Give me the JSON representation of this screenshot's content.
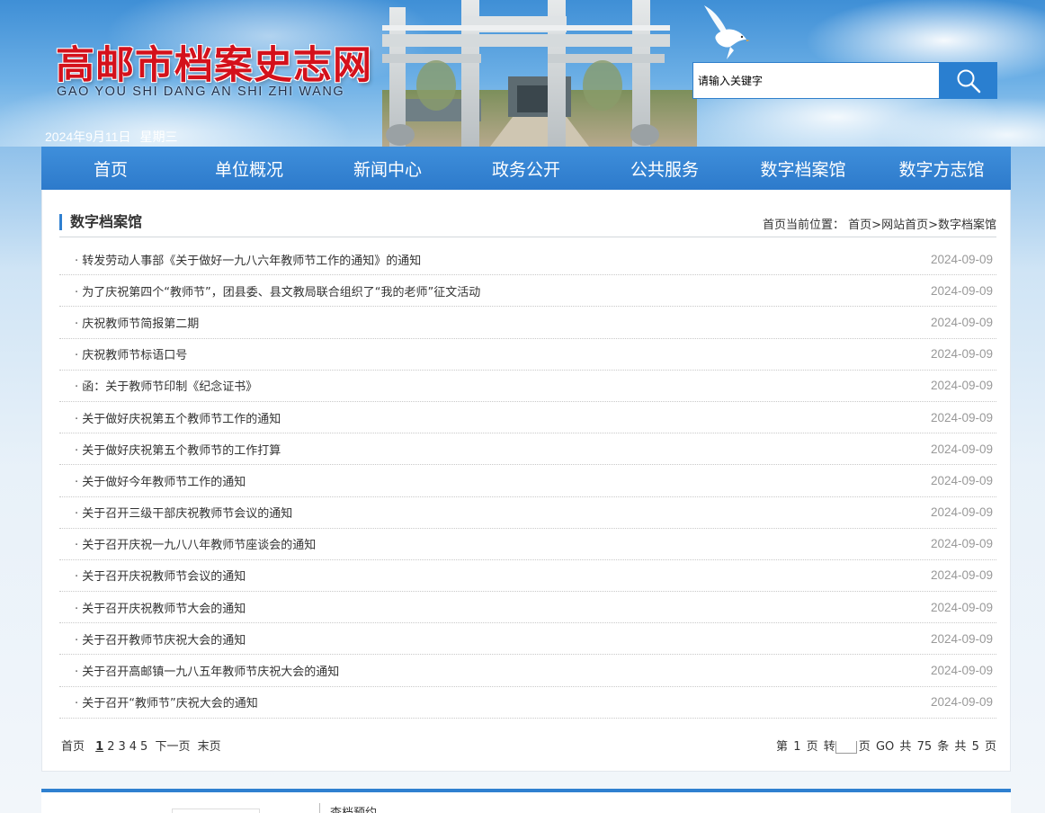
{
  "header": {
    "site_title": "高邮市档案史志网",
    "site_title_en": "GAO YOU SHI DANG AN SHI ZHI WANG",
    "date": "2024年9月11日",
    "weekday": "星期三",
    "search_placeholder": "请输入关键字"
  },
  "nav": {
    "items": [
      {
        "label": "首页"
      },
      {
        "label": "单位概况"
      },
      {
        "label": "新闻中心"
      },
      {
        "label": "政务公开"
      },
      {
        "label": "公共服务"
      },
      {
        "label": "数字档案馆"
      },
      {
        "label": "数字方志馆"
      }
    ]
  },
  "section": {
    "title": "数字档案馆",
    "breadcrumb_prefix": "首页当前位置：",
    "breadcrumb": [
      "首页",
      "网站首页",
      "数字档案馆"
    ],
    "breadcrumb_sep": ">"
  },
  "articles": [
    {
      "title": "转发劳动人事部《关于做好一九八六年教师节工作的通知》的通知",
      "date": "2024-09-09"
    },
    {
      "title": "为了庆祝第四个“教师节”，团县委、县文教局联合组织了“我的老师”征文活动",
      "date": "2024-09-09"
    },
    {
      "title": "庆祝教师节简报第二期",
      "date": "2024-09-09"
    },
    {
      "title": "庆祝教师节标语口号",
      "date": "2024-09-09"
    },
    {
      "title": "函：关于教师节印制《纪念证书》",
      "date": "2024-09-09"
    },
    {
      "title": "关于做好庆祝第五个教师节工作的通知",
      "date": "2024-09-09"
    },
    {
      "title": "关于做好庆祝第五个教师节的工作打算",
      "date": "2024-09-09"
    },
    {
      "title": "关于做好今年教师节工作的通知",
      "date": "2024-09-09"
    },
    {
      "title": "关于召开三级干部庆祝教师节会议的通知",
      "date": "2024-09-09"
    },
    {
      "title": "关于召开庆祝一九八八年教师节座谈会的通知",
      "date": "2024-09-09"
    },
    {
      "title": "关于召开庆祝教师节会议的通知",
      "date": "2024-09-09"
    },
    {
      "title": "关于召开庆祝教师节大会的通知",
      "date": "2024-09-09"
    },
    {
      "title": "关于召开教师节庆祝大会的通知",
      "date": "2024-09-09"
    },
    {
      "title": "关于召开高邮镇一九八五年教师节庆祝大会的通知",
      "date": "2024-09-09"
    },
    {
      "title": "关于召开“教师节”庆祝大会的通知",
      "date": "2024-09-09"
    }
  ],
  "pager": {
    "first": "首页",
    "pages": [
      "1",
      "2",
      "3",
      "4",
      "5"
    ],
    "current": "1",
    "next": "下一页",
    "last": "末页",
    "page_info_prefix": "第",
    "page_info_current": "1",
    "page_info_unit": "页",
    "goto_label": "转",
    "goto_unit": "页",
    "go_label": "GO",
    "total_prefix": "共",
    "total_items": "75",
    "total_items_unit": "条",
    "total_pages_prefix": "共",
    "total_pages": "5",
    "total_pages_unit": "页"
  },
  "footer": {
    "link_text": "查档预约"
  },
  "colors": {
    "nav_bg": "#2f80d0",
    "title_red": "#d4111b",
    "accent_blue": "#2f80d0",
    "date_gray": "#999999"
  }
}
